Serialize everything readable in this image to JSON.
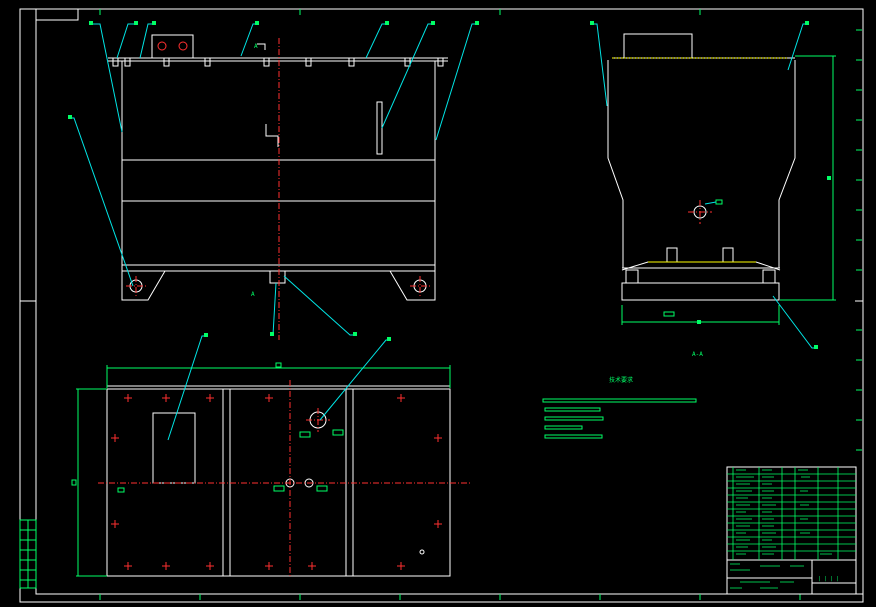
{
  "drawing": {
    "background": "#000000",
    "colors": {
      "outline": "#ffffff",
      "center_line": "#ff3030",
      "leader": "#00e5e5",
      "annotation": "#00ff66",
      "accent": "#ffff00"
    },
    "view_labels": {
      "front_section": "A",
      "side_section": "A-A"
    },
    "notes_title": "技术要求",
    "title_block": {
      "scale_marks": "| | | |"
    }
  }
}
